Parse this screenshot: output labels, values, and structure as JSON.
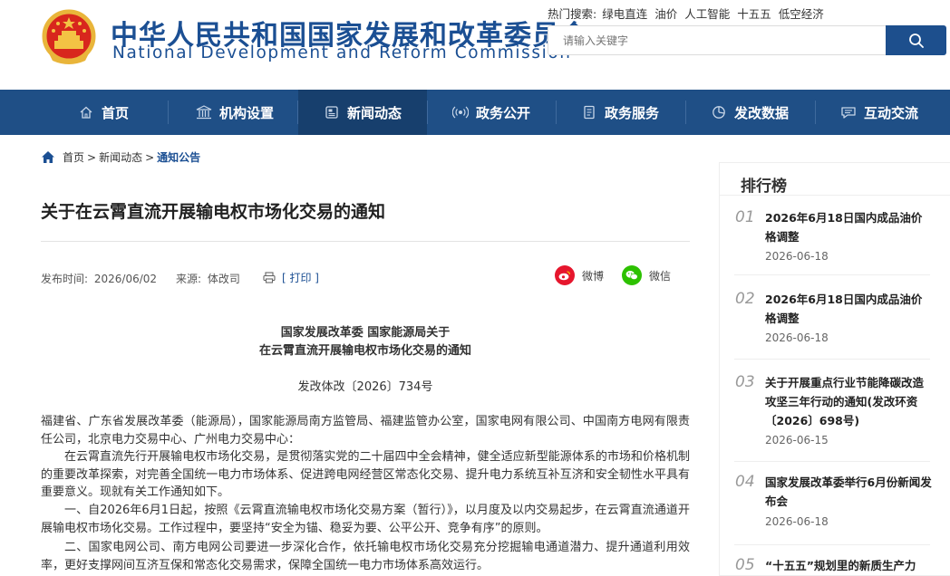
{
  "header": {
    "title_cn": "中华人民共和国国家发展和改革委员会",
    "title_en": "National Development and Reform Commission",
    "hot_label": "热门搜索:",
    "hot_items": [
      "绿电直连",
      "油价",
      "人工智能",
      "十五五",
      "低空经济"
    ],
    "search_placeholder": "请输入关键字"
  },
  "nav": {
    "items": [
      {
        "label": "首页",
        "icon": "home-icon"
      },
      {
        "label": "机构设置",
        "icon": "building-icon"
      },
      {
        "label": "新闻动态",
        "icon": "news-icon",
        "active": true
      },
      {
        "label": "政务公开",
        "icon": "broadcast-icon"
      },
      {
        "label": "政务服务",
        "icon": "document-icon"
      },
      {
        "label": "发改数据",
        "icon": "pie-chart-icon"
      },
      {
        "label": "互动交流",
        "icon": "chat-icon"
      }
    ]
  },
  "breadcrumb": {
    "items": [
      "首页",
      "新闻动态"
    ],
    "separator": ">",
    "current": "通知公告"
  },
  "article": {
    "title": "关于在云霄直流开展输电权市场化交易的通知",
    "publish_label": "发布时间:",
    "publish_date": "2026/06/02",
    "source_label": "来源:",
    "source": "体改司",
    "print_label": "[ 打印 ]",
    "share_weibo": "微博",
    "share_wechat": "微信",
    "doc_head_line1": "国家发展改革委 国家能源局关于",
    "doc_head_line2": "在云霄直流开展输电权市场化交易的通知",
    "doc_number": "发改体改〔2026〕734号",
    "paragraphs": [
      "福建省、广东省发展改革委（能源局），国家能源局南方监管局、福建监管办公室，国家电网有限公司、中国南方电网有限责任公司，北京电力交易中心、广州电力交易中心：",
      "在云霄直流先行开展输电权市场化交易，是贯彻落实党的二十届四中全会精神，健全适应新型能源体系的市场和价格机制的重要改革探索，对完善全国统一电力市场体系、促进跨电网经营区常态化交易、提升电力系统互补互济和安全韧性水平具有重要意义。现就有关工作通知如下。",
      "一、自2026年6月1日起，按照《云霄直流输电权市场化交易方案（暂行）》，以月度及以内交易起步，在云霄直流通道开展输电权市场化交易。工作过程中，要坚持“安全为锚、稳妥为要、公平公开、竞争有序”的原则。",
      "二、国家电网公司、南方电网公司要进一步深化合作，依托输电权市场化交易充分挖掘输电通道潜力、提升通道利用效率，更好支撑网间互济互保和常态化交易需求，保障全国统一电力市场体系高效运行。"
    ]
  },
  "ranking": {
    "title": "排行榜",
    "items": [
      {
        "num": "01",
        "text": "2026年6月18日国内成品油价格调整",
        "date": "2026-06-18"
      },
      {
        "num": "02",
        "text": "2026年6月18日国内成品油价格调整",
        "date": "2026-06-18"
      },
      {
        "num": "03",
        "text": "关于开展重点行业节能降碳改造攻坚三年行动的通知(发改环资〔2026〕698号)",
        "date": "2026-06-15"
      },
      {
        "num": "04",
        "text": "国家发展改革委举行6月份新闻发布会",
        "date": "2026-06-18"
      },
      {
        "num": "05",
        "text": "“十五五”规划里的新质生产力",
        "date": ""
      }
    ]
  },
  "colors": {
    "brand_blue": "#1b4f93",
    "nav_bg": "#1f4f86",
    "nav_active": "#173f6d",
    "weibo_red": "#e6162d",
    "wechat_green": "#2dc100"
  }
}
